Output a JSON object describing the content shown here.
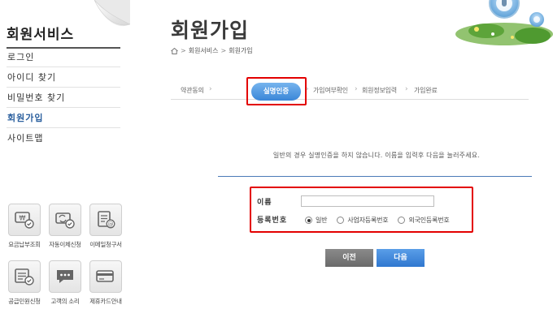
{
  "sidebar": {
    "title": "회원서비스",
    "menu": [
      {
        "label": "로그인"
      },
      {
        "label": "아이디 찾기"
      },
      {
        "label": "비밀번호 찾기"
      },
      {
        "label": "회원가입",
        "active": true
      },
      {
        "label": "사이트맵"
      }
    ],
    "quick_links": [
      {
        "label": "요금납부조회",
        "icon": "won-bill-icon"
      },
      {
        "label": "자동이체신청",
        "icon": "auto-transfer-icon"
      },
      {
        "label": "이메일청구서",
        "icon": "email-bill-icon"
      },
      {
        "label": "공급민원신청",
        "icon": "document-check-icon"
      },
      {
        "label": "고객의 소리",
        "icon": "speech-bubble-icon"
      },
      {
        "label": "제휴카드안내",
        "icon": "credit-card-icon"
      }
    ]
  },
  "header": {
    "title": "회원가입",
    "breadcrumb": [
      "회원서비스",
      "회원가입"
    ]
  },
  "steps": [
    {
      "label": "약관동의"
    },
    {
      "label": "실명인증",
      "active": true
    },
    {
      "label": "가입여부확인"
    },
    {
      "label": "회원정보입력"
    },
    {
      "label": "가입완료"
    }
  ],
  "notice": "일반의 경우 실명인증을 하지 않습니다. 이름을 입력후 다음을 눌러주세요.",
  "form": {
    "name_label": "이름",
    "name_value": "",
    "reg_label": "등록번호",
    "options": [
      {
        "label": "일반",
        "checked": true
      },
      {
        "label": "사업자등록번호",
        "checked": false
      },
      {
        "label": "외국인등록번호",
        "checked": false
      }
    ]
  },
  "buttons": {
    "prev": "이전",
    "next": "다음"
  },
  "colors": {
    "accent": "#3a86d8",
    "highlight": "#e30000",
    "active_menu": "#2a5f9e"
  }
}
